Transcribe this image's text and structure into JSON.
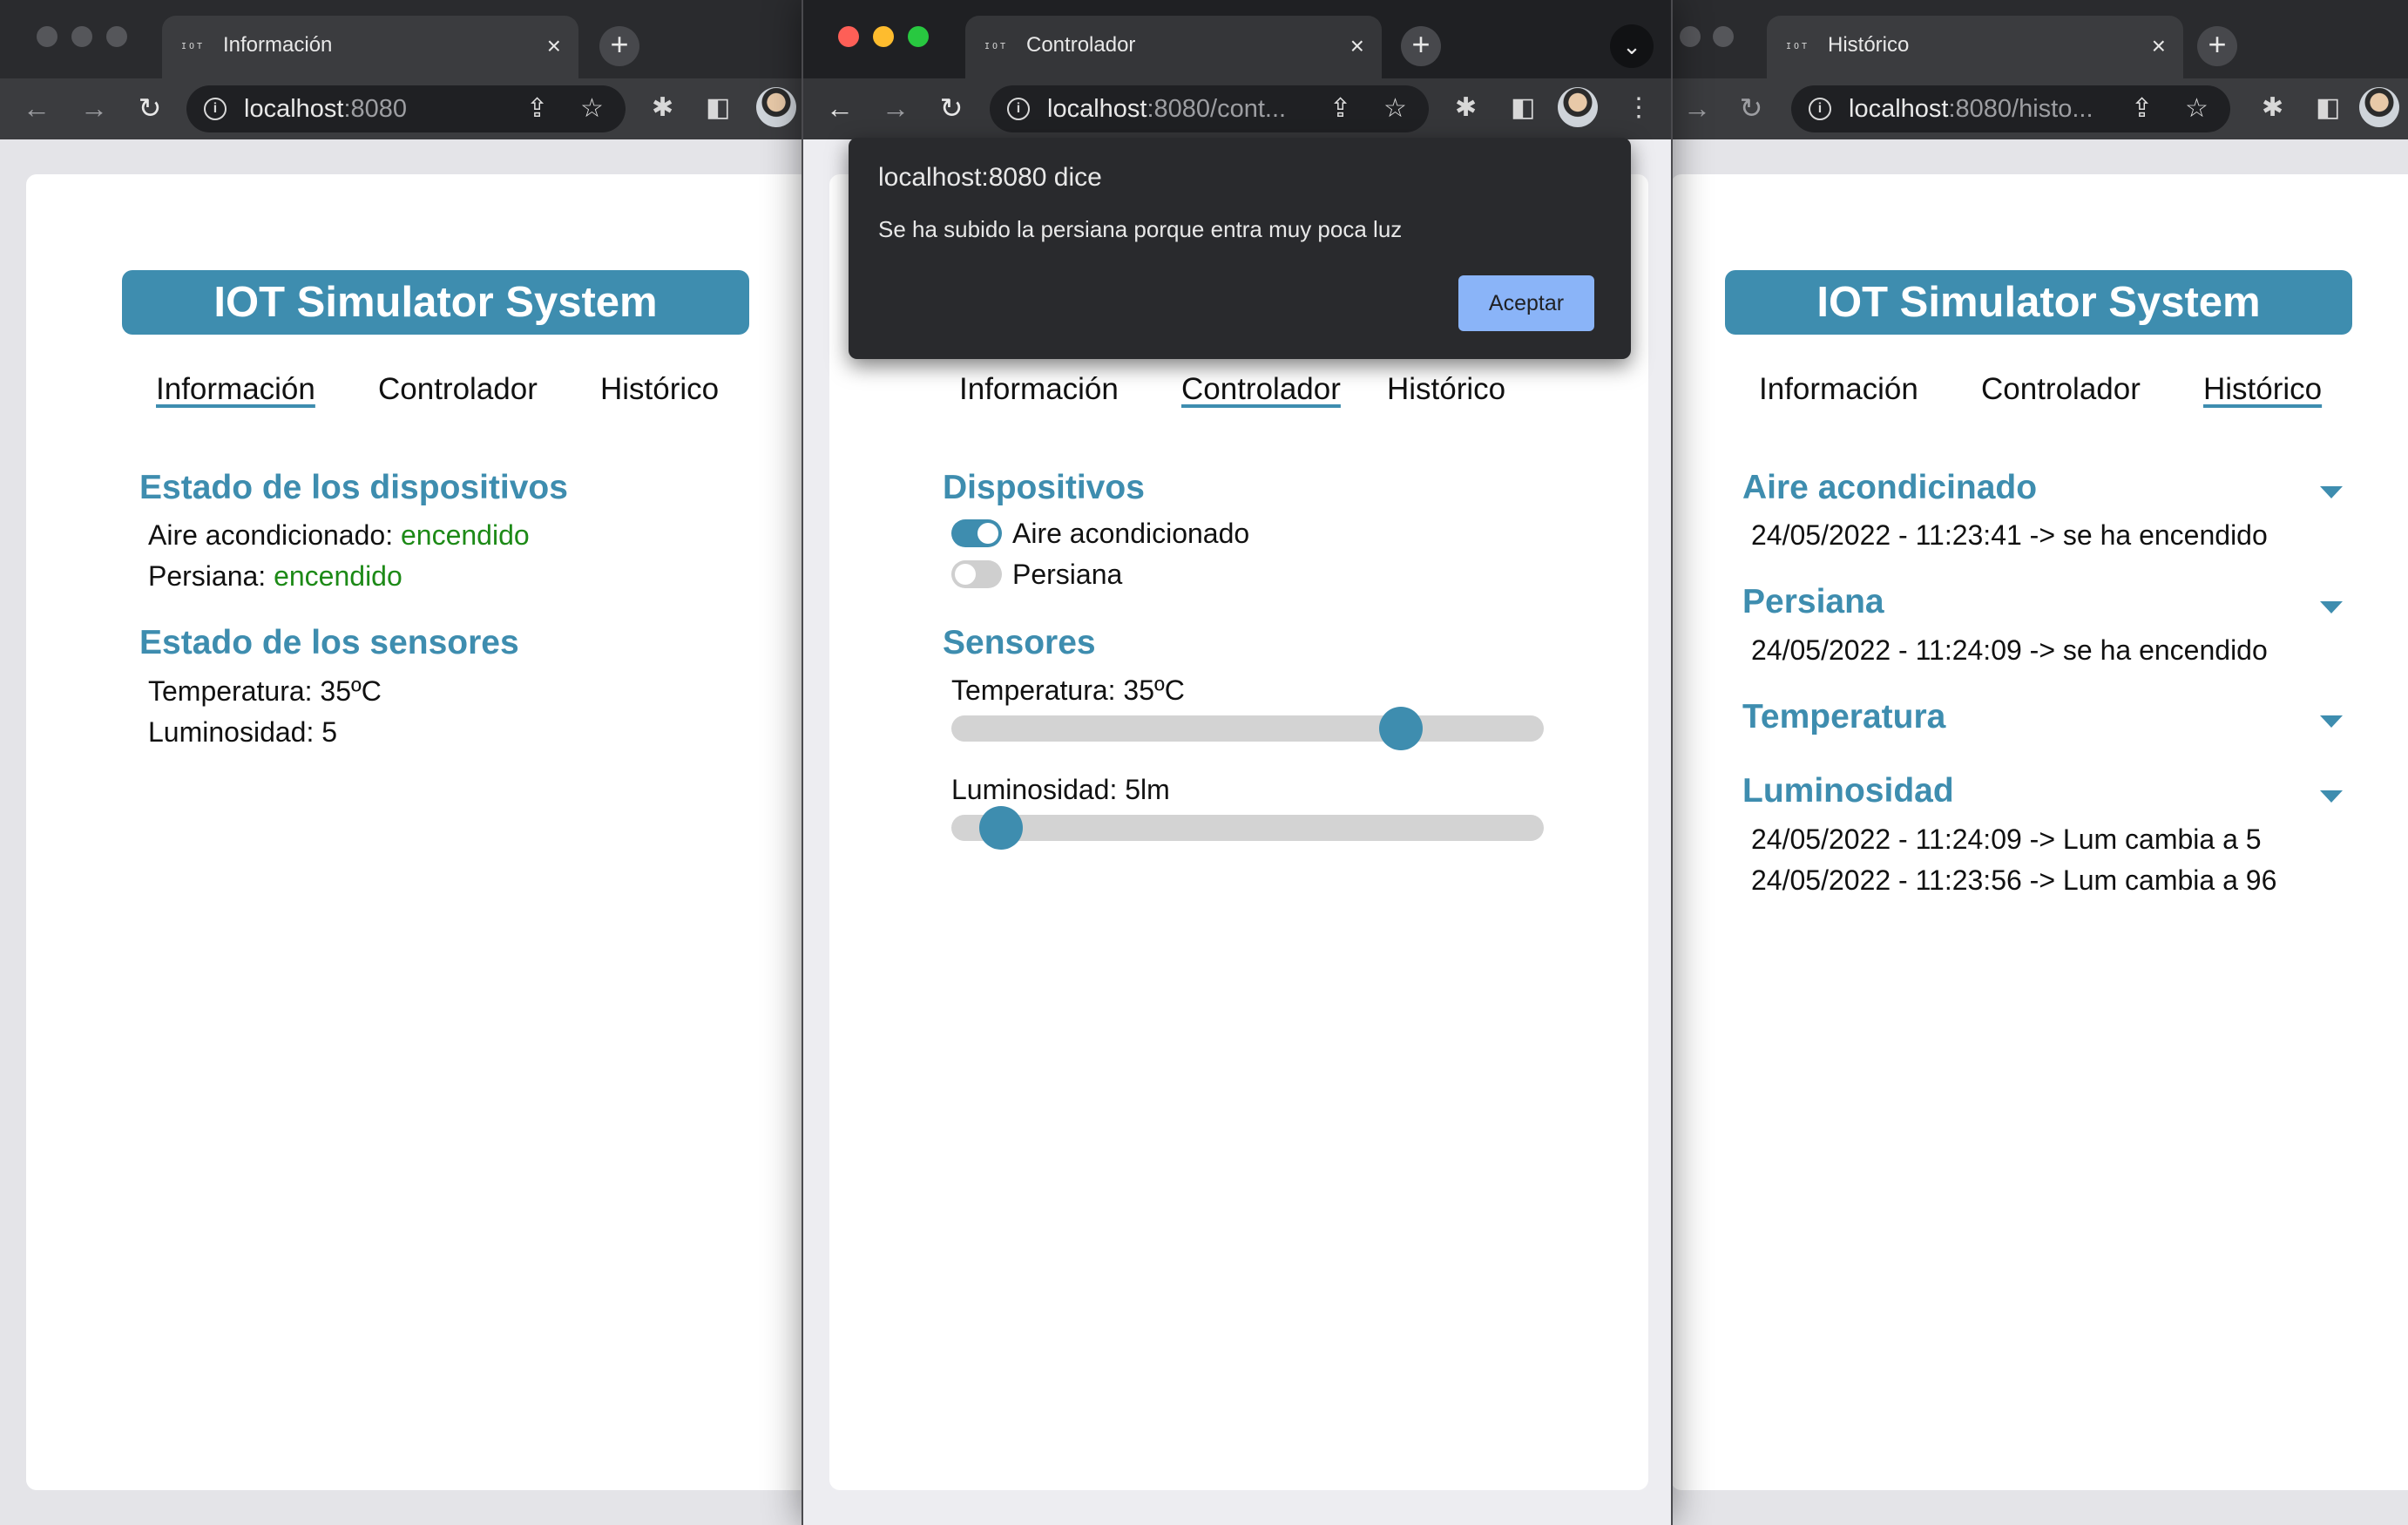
{
  "app_title": "IOT Simulator System",
  "nav_links": [
    "Información",
    "Controlador",
    "Histórico"
  ],
  "windows": {
    "left": {
      "tab_title": "Información",
      "url_host": "localhost",
      "url_rest": ":8080",
      "devices_title": "Estado de los dispositivos",
      "air_label": "Aire acondicionado:",
      "air_value": "encendido",
      "blind_label": "Persiana:",
      "blind_value": "encendido",
      "sensors_title": "Estado de los sensores",
      "temperature_text": "Temperatura: 35ºC",
      "luminosity_text": "Luminosidad: 5"
    },
    "center": {
      "tab_title": "Controlador",
      "url_host": "localhost",
      "url_rest": ":8080/cont...",
      "devices_title": "Dispositivos",
      "air_toggle_label": "Aire acondicionado",
      "air_toggle_on": true,
      "blind_toggle_label": "Persiana",
      "blind_toggle_on": false,
      "sensors_title": "Sensores",
      "temperature_label": "Temperatura: 35ºC",
      "temperature_slider_fraction": 0.78,
      "luminosity_label": "Luminosidad: 5lm",
      "luminosity_slider_fraction": 0.05,
      "dialog": {
        "title": "localhost:8080 dice",
        "message": "Se ha subido la persiana porque entra muy poca luz",
        "accept_label": "Aceptar"
      }
    },
    "right": {
      "tab_title": "Histórico",
      "url_host": "localhost",
      "url_rest": ":8080/histo...",
      "sections": [
        {
          "title": "Aire acondicinado",
          "entries": [
            "24/05/2022 - 11:23:41 -> se ha encendido"
          ]
        },
        {
          "title": "Persiana",
          "entries": [
            "24/05/2022 - 11:24:09 -> se ha encendido"
          ]
        },
        {
          "title": "Temperatura",
          "entries": []
        },
        {
          "title": "Luminosidad",
          "entries": [
            "24/05/2022 - 11:24:09 -> Lum cambia a 5",
            "24/05/2022 - 11:23:56 -> Lum cambia a 96"
          ]
        }
      ]
    }
  },
  "icons": {
    "favicon": "IOT",
    "close": "×",
    "plus": "+",
    "back": "←",
    "forward": "→",
    "reload": "↻",
    "share": "⇪",
    "star": "☆",
    "extensions": "✱",
    "sidepanel": "◧",
    "menu": "⋮",
    "tabmenu": "⌄"
  },
  "colors": {
    "accent": "#3e8daf",
    "status_on": "#1d8a17",
    "dialog_bg": "#292a2d",
    "dialog_button": "#8ab4f8"
  }
}
